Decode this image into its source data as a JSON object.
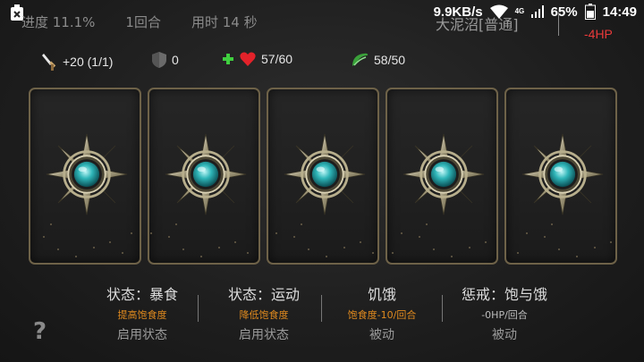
{
  "status_bar": {
    "network_speed": "9.9KB/s",
    "network_type": "4G",
    "battery_percent": "65%",
    "time": "14:49"
  },
  "header": {
    "progress": "进度 11.1%",
    "round": "1回合",
    "elapsed": "用时 14 秒",
    "level": "大泥沼[普通]",
    "hp_change": "-4HP"
  },
  "stats": {
    "attack": "+20 (1/1)",
    "defense": "0",
    "health": "57/60",
    "satiety": "58/50"
  },
  "cards": [
    {
      "state": "face-down"
    },
    {
      "state": "face-down"
    },
    {
      "state": "face-down"
    },
    {
      "state": "face-down"
    },
    {
      "state": "face-down"
    }
  ],
  "statuses": [
    {
      "title": "状态：暴食",
      "desc": "提高饱食度",
      "action": "启用状态"
    },
    {
      "title": "状态：运动",
      "desc": "降低饱食度",
      "action": "启用状态"
    },
    {
      "title": "饥饿",
      "desc": "饱食度-10/回合",
      "action": "被动"
    },
    {
      "title": "惩戒：饱与饿",
      "desc": "-0HP/回合",
      "action": "被动"
    }
  ],
  "help_label": "?",
  "colors": {
    "accent_orange": "#e08a1e",
    "hp_red": "#e83a3a",
    "satiety_green": "#3aa13a",
    "card_border": "#6e6248",
    "gem_teal": "#2fb5b8"
  }
}
